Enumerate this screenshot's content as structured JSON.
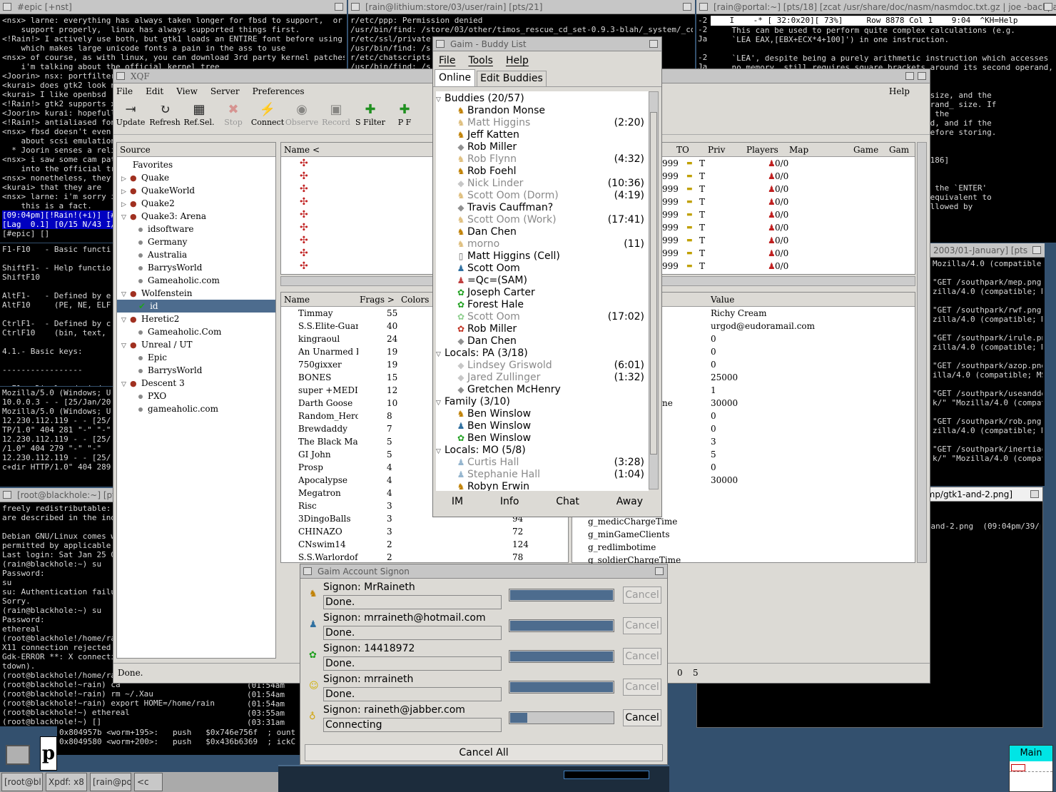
{
  "epic": {
    "title": "#epic [+nst]",
    "lines": [
      "<nsx> larne: everything has always taken longer for fbsd to support,  or",
      "    support properly,  linux has always supported things first.",
      "<!Rain!> I actively use both, but gtk1 loads an ENTIRE font before using it,",
      "    which makes large unicode fonts a pain in the ass to use",
      "<nsx> of course, as with linux, you can download 3rd party kernel patches, but",
      "    i'm talking about the official kernel tree",
      "<Joorin> nsx: portfilteri",
      "<kurai> does gtk2 look ni",
      "<kurai> I like openbsd",
      "<!Rain!> gtk2 supports xf",
      "<Joorin> kurai: hopefully",
      "<!Rain!> antialiased font",
      "<nsx> fbsd doesn't even h",
      "    about scsi emulation",
      "  * Joorin senses a religio",
      "<nsx> i saw some cam patc",
      "    into the official tre",
      "<nsx> nonetheless, they'r",
      "<kurai> that they are",
      "<nsx> larne: i'm sorry i",
      "    this is a fact.",
      "[09:04pm][!Rain!(+i)] [#",
      "[Lag  0.1] [0/15 N/43 I/",
      "[#epic] []"
    ]
  },
  "lithium": {
    "title": "[rain@lithium:store/03/user/rain] [pts/21]",
    "lines": [
      "r/etc/ppp: Permission denied",
      "/usr/bin/find: /store/03/other/timos_rescue_cd_set-0.9.3-blah/_system/_cd/dev/va",
      "r/etc/ssl/private:",
      "/usr/bin/find: /s",
      "r/etc/chatscripts:",
      "/usr/bin/find: /s"
    ]
  },
  "portal_nasm": {
    "title": "[rain@portal:~] [pts/18] [zcat /usr/share/doc/nasm/nasmdoc.txt.gz | joe -backpa",
    "status": "    I    -* [ 32:0x20][ 73%]     Row 8878 Col 1    9:04  ^KH=Help",
    "lines": [
      "    This can be used to perform quite complex calculations (e.g.",
      "    `LEA EAX,[EBX+ECX*4+100]') in one instruction.",
      "",
      "    `LEA', despite being a purely arithmetic instruction which accesses",
      "    no memory, still requires square brackets around its second operand,",
      "",
      "",
      "                                     address_ size, and the",
      "                                     rent _operand_ size. If",
      "                                     , then if the",
      "                                     are stored, and if the",
      "                                     32-bits before storing.",
      "",
      "",
      "                                             [186]",
      "",
      "",
      "                                     reated by the `ENTER'",
      "                                     tionally equivalent to",
      "                                     SP,BP' followed by"
    ],
    "gutter": [
      "-2",
      "-2",
      "Ja",
      "",
      "-2",
      "Ja"
    ]
  },
  "joe_help": {
    "lines": [
      "F1-F10   - Basic function",
      "",
      "ShiftF1- - Help functions",
      "ShiftF10",
      "",
      "AltF1-   - Defined by exe",
      "AltF10     (PE, NE, ELF,",
      "",
      "CtrlF1-  - Defined by cur",
      "CtrlF10    (bin, text, he",
      "",
      "4.1.- Basic keys:",
      "",
      "-----------------",
      "",
      "  F1 - Displayed window \""
    ]
  },
  "apache_log": {
    "lines": [
      "Mozilla/5.0 (Windows; U;",
      "10.0.0.3 - - [25/Jan/2003",
      "Mozilla/5.0 (Windows; U;",
      "12.230.112.119 - - [25/Ja",
      "TP/1.0\" 404 281 \"-\" \"-\"",
      "12.230.112.119 - - [25/Ja",
      "/1.0\" 404 279 \"-\" \"-\"",
      "12.230.112.119 - - [25/Ja",
      "c+dir HTTP/1.0\" 404 289 \""
    ]
  },
  "blackhole": {
    "title": "[root@blackhole:~] [pts",
    "lines": [
      "freely redistributable: t",
      "are described in the indi",
      "",
      "Debian GNU/Linux comes wi",
      "permitted by applicable l",
      "Last login: Sat Jan 25 01",
      "(rain@blackhole:~) su",
      "Password:",
      "su",
      "su: Authentication failur",
      "Sorry.",
      "(rain@blackhole:~) su",
      "Password:",
      "ethereal",
      "(root@blackhole!/home/rai",
      "X11 connection rejected b",
      "Gdk-ERROR **: X connectio",
      "tdown).",
      "(root@blackhole!/home/rai",
      "(root@blackhole!~rain) ca",
      "(root@blackhole!~rain) rm ~/.Xau",
      "(root@blackhole!~rain) export HOME=/home/rain",
      "(root@blackhole!~) ethereal",
      "(root@blackhole!~) []"
    ],
    "right": [
      "(01:54am",
      "(01:54am",
      "(01:54am",
      "(03:55am",
      "(03:31am"
    ]
  },
  "gdb": {
    "lines": [
      "0x804957b <worm+195>:   push   $0x746e756f  ; ount",
      "0x8049580 <worm+200>:   push   $0x436b6369  ; ickC"
    ]
  },
  "southpark": {
    "title": "2003/01-January] [pts",
    "lines": [
      "Mozilla/4.0 (compatible; MSI",
      "",
      "\"GET /southpark/mep.png H",
      "zilla/4.0 (compatible; MSIE",
      "",
      "\"GET /southpark/rwf.png H",
      "zilla/4.0 (compatible; MSIE",
      "",
      "\"GET /southpark/irule.png",
      "zilla/4.0 (compatible; MSI",
      "",
      "\"GET /southpark/azop.png",
      "illa/4.0 (compatible; MSIE",
      "",
      "\"GET /southpark/useanddes",
      "k/\" \"Mozilla/4.0 (compati",
      "",
      "\"GET /southpark/rob.png H",
      "zilla/4.0 (compatible; MSIE",
      "",
      "\"GET /southpark/inertiacr",
      "k/\" \"Mozilla/4.0 (compati"
    ]
  },
  "import_term": {
    "title": "[rain@portal:/tmp] [pts/9] [import -window root /tmp/gtk1-and-2.png]",
    "prompt": "(rain@portal:/tmp) import -window root /tmp/gtk1-and-2.png",
    "right": "(09:04pm/39/pts/9)"
  },
  "xqf": {
    "title": "XQF",
    "menu": [
      "File",
      "Edit",
      "View",
      "Server",
      "Preferences"
    ],
    "help": "Help",
    "toolbar": [
      {
        "icon": "update-icon",
        "glyph": "⇥",
        "label": "Update"
      },
      {
        "icon": "refresh-icon",
        "glyph": "↻",
        "label": "Refresh"
      },
      {
        "icon": "refresh-selected-icon",
        "glyph": "▦",
        "label": "Ref.Sel."
      },
      {
        "icon": "stop-icon",
        "glyph": "✖",
        "label": "Stop"
      },
      {
        "icon": "connect-icon",
        "glyph": "⚡",
        "label": "Connect"
      },
      {
        "icon": "observe-icon",
        "glyph": "◉",
        "label": "Observe"
      },
      {
        "icon": "record-icon",
        "glyph": "▣",
        "label": "Record"
      },
      {
        "icon": "server-filter-icon",
        "glyph": "✚",
        "label": "S Filter"
      },
      {
        "icon": "player-filter-icon",
        "glyph": "✚",
        "label": "P F"
      }
    ],
    "source_header": "Source",
    "tree": [
      {
        "label": "Favorites",
        "level": 0,
        "arrow": ""
      },
      {
        "label": "Quake",
        "level": 0,
        "arrow": "▷",
        "icon": "Q"
      },
      {
        "label": "QuakeWorld",
        "level": 0,
        "arrow": "▷",
        "icon": "Q"
      },
      {
        "label": "Quake2",
        "level": 0,
        "arrow": "▷",
        "icon": "Q"
      },
      {
        "label": "Quake3: Arena",
        "level": 0,
        "arrow": "▽",
        "icon": "Q"
      },
      {
        "label": "idsoftware",
        "level": 1
      },
      {
        "label": "Germany",
        "level": 1
      },
      {
        "label": "Australia",
        "level": 1
      },
      {
        "label": "BarrysWorld",
        "level": 1
      },
      {
        "label": "Gameaholic.com",
        "level": 1
      },
      {
        "label": "Wolfenstein",
        "level": 0,
        "arrow": "▽",
        "icon": "W"
      },
      {
        "label": "id",
        "level": 1,
        "sel": true
      },
      {
        "label": "Heretic2",
        "level": 0,
        "arrow": "▽",
        "icon": "H"
      },
      {
        "label": "Gameaholic.Com",
        "level": 1
      },
      {
        "label": "Unreal / UT",
        "level": 0,
        "arrow": "▽",
        "icon": "U"
      },
      {
        "label": "Epic",
        "level": 1
      },
      {
        "label": "BarrysWorld",
        "level": 1
      },
      {
        "label": "Descent 3",
        "level": 0,
        "arrow": "▽",
        "icon": "D"
      },
      {
        "label": "PXO",
        "level": 1
      },
      {
        "label": "gameaholic.com",
        "level": 1
      }
    ],
    "server_cols": [
      "Name <",
      "TO",
      "Priv",
      "Players",
      "Map",
      "Game",
      "Gam"
    ],
    "server_rows": [
      "999",
      "999",
      "999",
      "999",
      "999",
      "999",
      "999",
      "999",
      "999"
    ],
    "server_to": "T",
    "server_players": "0/0",
    "player_cols": [
      "Name",
      "Frags >",
      "Colors"
    ],
    "players": [
      [
        "Timmay",
        "55"
      ],
      [
        "S.S.Elite-Guard",
        "40"
      ],
      [
        "kingraoul",
        "24"
      ],
      [
        "An Unarmed Bl",
        "19"
      ],
      [
        "750gixxer",
        "19"
      ],
      [
        "BONES",
        "15"
      ],
      [
        "super +MEDIC-",
        "12"
      ],
      [
        "Darth Goose",
        "10"
      ],
      [
        "Random_Hero",
        "8"
      ],
      [
        "Brewdaddy",
        "7"
      ],
      [
        "The Black Man",
        "5"
      ],
      [
        "GI John",
        "5"
      ],
      [
        "Prosp",
        "4"
      ],
      [
        "Apocalypse",
        "4"
      ],
      [
        "Megatron",
        "4"
      ],
      [
        "Risc",
        "3"
      ],
      [
        "3DingoBalls",
        "3"
      ],
      [
        "CHINAZO",
        "3"
      ],
      [
        "CNswim14",
        "2"
      ],
      [
        "S.S.WarlordofV",
        "2"
      ]
    ],
    "pings": [
      "94",
      "72",
      "124",
      "78"
    ],
    "rules_cols": [
      "Value"
    ],
    "rules_values": [
      "Richy Cream",
      "urgod@eudoramail.com",
      "0",
      "0",
      "0",
      "25000",
      "1",
      "30000",
      "0",
      "0",
      "3",
      "5",
      "0",
      "30000"
    ],
    "rules_frag": "ne",
    "rules_names": [
      "g_medicChargeTime",
      "g_minGameClients",
      "g_redlimbotime",
      "g_soldierChargeTime"
    ],
    "status": "Done.",
    "status_right": [
      "0",
      "5"
    ]
  },
  "gaim": {
    "title": "Gaim - Buddy List",
    "menu": [
      "File",
      "Tools",
      "Help"
    ],
    "tabs": [
      "Online",
      "Edit Buddies"
    ],
    "groups": [
      {
        "name": "Buddies (20/57)",
        "buddies": [
          {
            "n": "Brandon Monse",
            "s": "aim"
          },
          {
            "n": "Matt Higgins",
            "s": "aim",
            "idle": true,
            "t": "(2:20)"
          },
          {
            "n": "Jeff Katten",
            "s": "aim"
          },
          {
            "n": "Rob Miller",
            "s": "gray"
          },
          {
            "n": "Rob Flynn",
            "s": "aim",
            "idle": true,
            "t": "(4:32)"
          },
          {
            "n": "Rob Foehl",
            "s": "aim"
          },
          {
            "n": "Nick Linder",
            "s": "gray",
            "idle": true,
            "t": "(10:36)"
          },
          {
            "n": "Scott Oom (Dorm)",
            "s": "aim",
            "idle": true,
            "t": "(4:19)"
          },
          {
            "n": "Travis Cauffman?",
            "s": "gray"
          },
          {
            "n": "Scott Oom (Work)",
            "s": "aim",
            "idle": true,
            "t": "(17:41)"
          },
          {
            "n": "Dan Chen",
            "s": "aim"
          },
          {
            "n": "morno",
            "s": "aim",
            "idle": true,
            "t": "(11)"
          },
          {
            "n": "Matt Higgins (Cell)",
            "s": "cell"
          },
          {
            "n": "Scott Oom",
            "s": "msn"
          },
          {
            "n": "=Qc=(SAM)",
            "s": "msn2"
          },
          {
            "n": "Joseph Carter",
            "s": "icq"
          },
          {
            "n": "Forest Hale",
            "s": "icq"
          },
          {
            "n": "Scott Oom",
            "s": "icq",
            "idle": true,
            "t": "(17:02)"
          },
          {
            "n": "Rob Miller",
            "s": "icqr"
          },
          {
            "n": "Dan Chen",
            "s": "gray"
          }
        ]
      },
      {
        "name": "Locals: PA (3/18)",
        "buddies": [
          {
            "n": "Lindsey Griswold",
            "s": "gray",
            "idle": true,
            "t": "(6:01)"
          },
          {
            "n": "Jared Zullinger",
            "s": "gray",
            "idle": true,
            "t": "(1:32)"
          },
          {
            "n": "Gretchen McHenry",
            "s": "gray"
          }
        ]
      },
      {
        "name": "Family (3/10)",
        "buddies": [
          {
            "n": "Ben Winslow",
            "s": "aim"
          },
          {
            "n": "Ben Winslow",
            "s": "msn"
          },
          {
            "n": "Ben Winslow",
            "s": "icq"
          }
        ]
      },
      {
        "name": "Locals: MO (5/8)",
        "buddies": [
          {
            "n": "Curtis Hall",
            "s": "msn",
            "idle": true,
            "t": "(3:28)"
          },
          {
            "n": "Stephanie Hall",
            "s": "msn",
            "idle": true,
            "t": "(1:04)"
          },
          {
            "n": "Robyn Erwin",
            "s": "aim"
          }
        ]
      }
    ],
    "buttons": [
      "IM",
      "Info",
      "Chat",
      "Away"
    ]
  },
  "signon": {
    "title": "Gaim Account Signon",
    "rows": [
      {
        "label": "Signon: MrRaineth",
        "status": "Done.",
        "progress": 1.0,
        "icon": "aim",
        "cancel": "Cancel",
        "enabled": false
      },
      {
        "label": "Signon: mrraineth@hotmail.com",
        "status": "Done.",
        "progress": 1.0,
        "icon": "msn",
        "cancel": "Cancel",
        "enabled": false
      },
      {
        "label": "Signon: 14418972",
        "status": "Done.",
        "progress": 1.0,
        "icon": "icq",
        "cancel": "Cancel",
        "enabled": false
      },
      {
        "label": "Signon: mrraineth",
        "status": "Done.",
        "progress": 1.0,
        "icon": "yahoo",
        "cancel": "Cancel",
        "enabled": false
      },
      {
        "label": "Signon: raineth@jabber.com",
        "status": "Connecting",
        "progress": 0.18,
        "icon": "jabber",
        "cancel": "Cancel",
        "enabled": true
      }
    ],
    "cancel_all": "Cancel All"
  },
  "taskbar": {
    "items": [
      "[root@bl",
      "Xpdf: x8",
      "[rain@po",
      "<c"
    ],
    "pager": "Main"
  }
}
